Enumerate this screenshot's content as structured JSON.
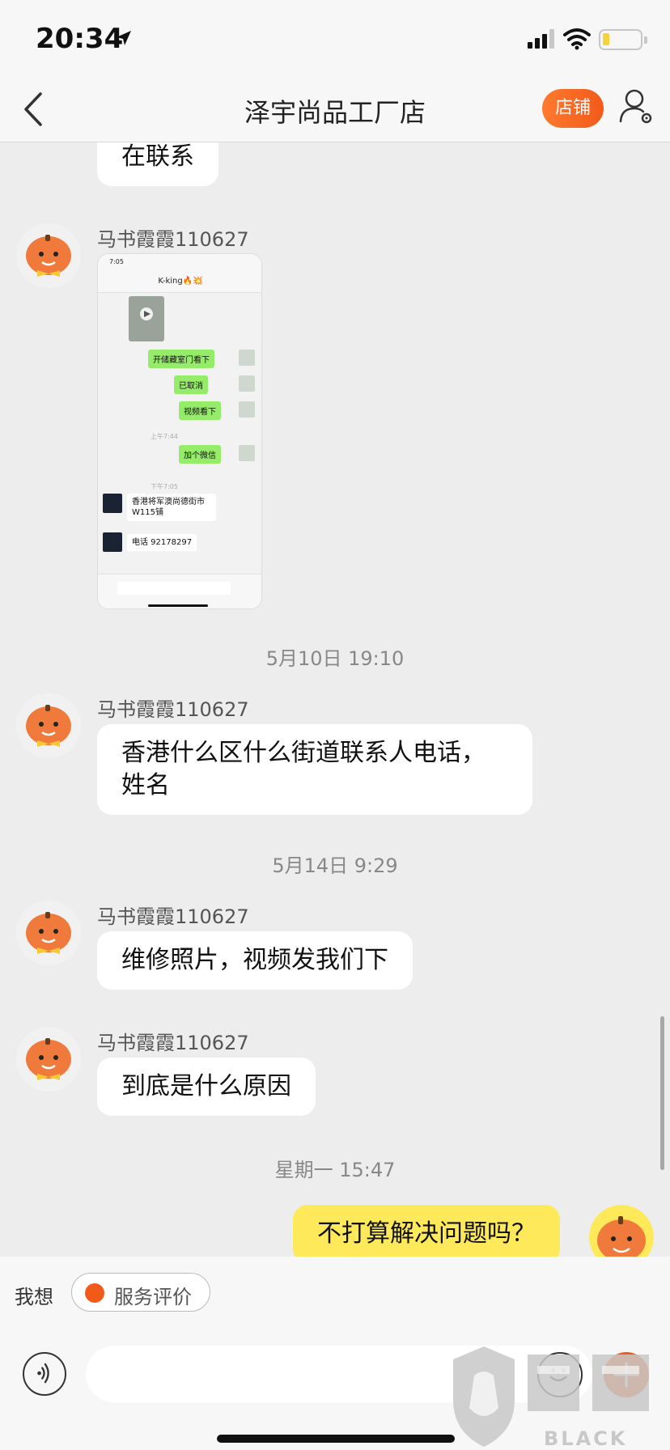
{
  "status_bar": {
    "time": "20:34"
  },
  "nav": {
    "title": "泽宇尚品工厂店",
    "shop_button": "店铺"
  },
  "messages": [
    {
      "sender": "",
      "text": "在联系"
    },
    {
      "sender": "马书霞霞110627",
      "image": {
        "time": "7:05",
        "title": "K-king🔥💥",
        "sent": [
          "开储藏室门看下",
          "已取消",
          "视频看下"
        ],
        "time1": "上午7:44",
        "sent2": "加个微信",
        "time2": "下午7:05",
        "received": [
          "香港将军澳尚德街市W115铺",
          "电话 92178297"
        ]
      }
    },
    {
      "timestamp": "5月10日 19:10",
      "sender": "马书霞霞110627",
      "text": "香港什么区什么街道联系人电话，姓名"
    },
    {
      "timestamp": "5月14日 9:29",
      "sender": "马书霞霞110627",
      "text": "维修照片，视频发我们下"
    },
    {
      "sender": "马书霞霞110627",
      "text": "到底是什么原因"
    },
    {
      "timestamp": "星期一 15:47",
      "text": "不打算解决问题吗？",
      "from_me": true
    }
  ],
  "bottom": {
    "quick_label": "我想",
    "chip_label": "服务评价"
  },
  "watermark": {
    "text": "BLACK CAT"
  },
  "colors": {
    "accent": "#f25a1a",
    "my_bubble": "#fde95a",
    "wechat_green": "#95ec69"
  },
  "icons": [
    "location-arrow-icon",
    "signal-icon",
    "wifi-icon",
    "battery-icon",
    "back-chevron-icon",
    "user-settings-icon",
    "voice-icon",
    "emoji-icon",
    "plus-icon",
    "rating-icon"
  ]
}
